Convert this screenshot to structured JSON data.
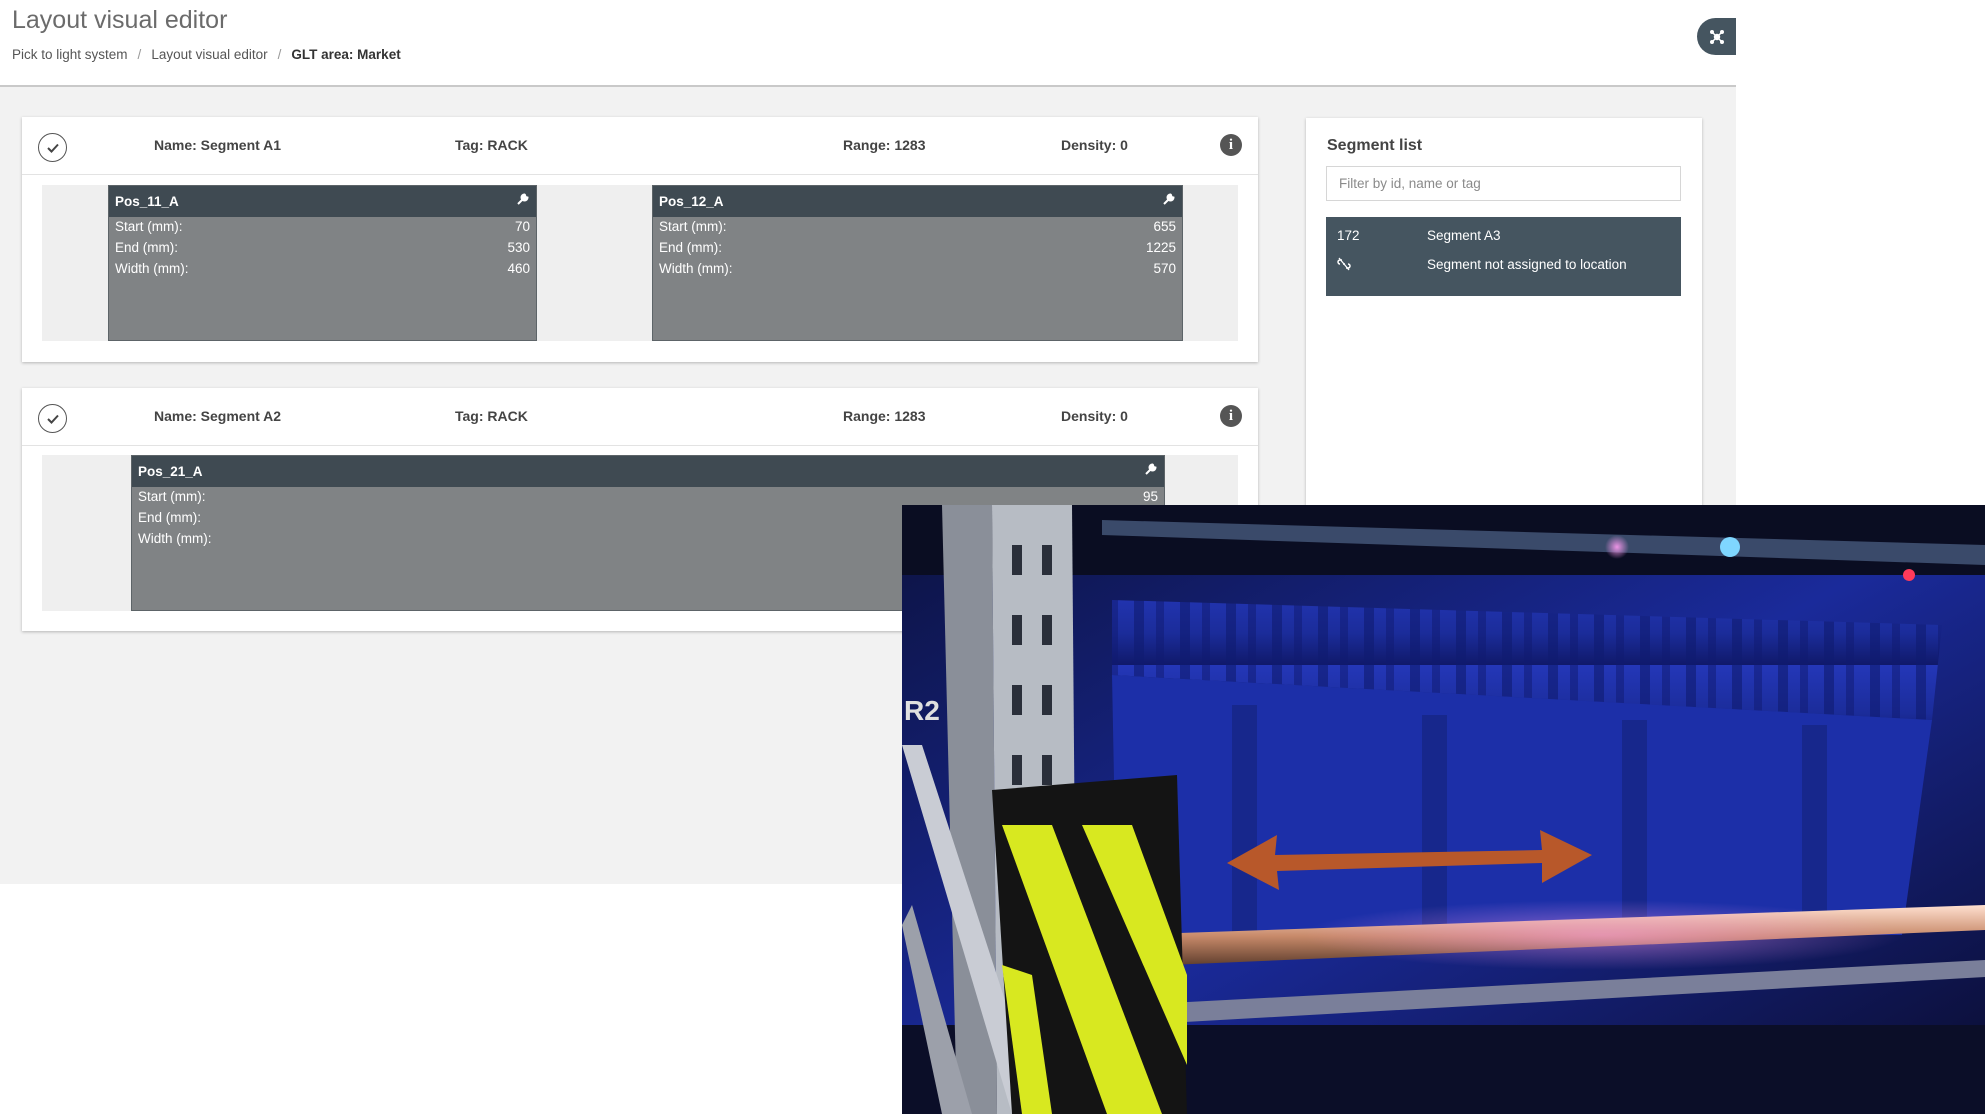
{
  "header": {
    "title": "Layout visual editor",
    "breadcrumb": [
      "Pick to light system",
      "Layout visual editor",
      "GLT area: Market"
    ],
    "fab_icon": "network-settings-icon"
  },
  "segments": [
    {
      "name": "Name: Segment A1",
      "tag": "Tag: RACK",
      "range": "Range: 1283",
      "density": "Density: 0",
      "positions": [
        {
          "name": "Pos_11_A",
          "start_label": "Start (mm):",
          "start": "70",
          "end_label": "End (mm):",
          "end": "530",
          "width_label": "Width (mm):",
          "width": "460"
        },
        {
          "name": "Pos_12_A",
          "start_label": "Start (mm):",
          "start": "655",
          "end_label": "End (mm):",
          "end": "1225",
          "width_label": "Width (mm):",
          "width": "570"
        }
      ]
    },
    {
      "name": "Name: Segment A2",
      "tag": "Tag: RACK",
      "range": "Range: 1283",
      "density": "Density: 0",
      "positions": [
        {
          "name": "Pos_21_A",
          "start_label": "Start (mm):",
          "start": "95",
          "end_label": "End (mm):",
          "end": "",
          "width_label": "Width (mm):",
          "width": ""
        }
      ]
    }
  ],
  "sidebar": {
    "title": "Segment list",
    "filter_placeholder": "Filter by id, name or tag",
    "items": [
      {
        "id": "172",
        "name": "Segment A3",
        "note": "Segment not assigned to location",
        "icon": "unlink-icon"
      }
    ]
  },
  "photo": {
    "subject": "shelf-rack-with-blue-bins-and-light-bar",
    "arrow_color": "#b8582a"
  },
  "colors": {
    "dark_header": "#3f4a52",
    "position_body": "#808385",
    "accent_dark": "#455560"
  }
}
